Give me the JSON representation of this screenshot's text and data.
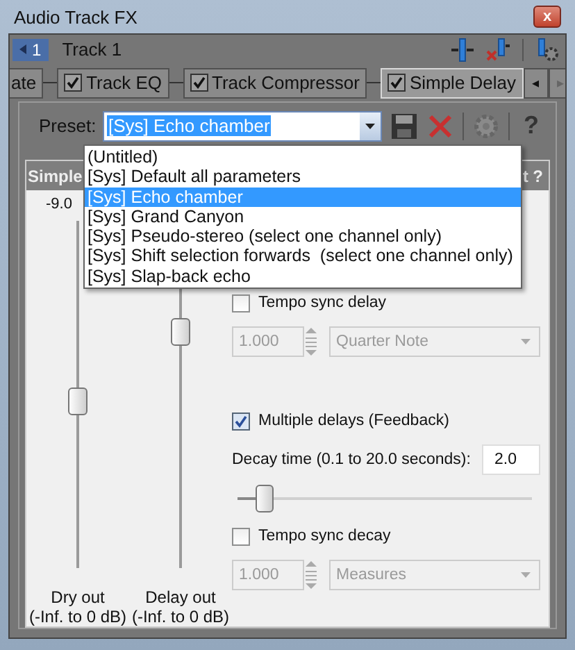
{
  "window": {
    "title": "Audio Track FX",
    "close": "x"
  },
  "track": {
    "number": "1",
    "name": "Track 1"
  },
  "chain": {
    "cut_plugin": "ate",
    "plugins": [
      {
        "label": "Track EQ",
        "checked": true,
        "selected": false
      },
      {
        "label": "Track Compressor",
        "checked": true,
        "selected": false
      },
      {
        "label": "Simple Delay",
        "checked": true,
        "selected": true
      }
    ],
    "scroll_left": "◂",
    "scroll_right": "▸"
  },
  "preset": {
    "label": "Preset:",
    "value": "[Sys] Echo chamber",
    "help": "?",
    "options": [
      {
        "label": "(Untitled)",
        "selected": false
      },
      {
        "label": "[Sys] Default all parameters",
        "selected": false
      },
      {
        "label": "[Sys] Echo chamber",
        "selected": true
      },
      {
        "label": "[Sys] Grand Canyon",
        "selected": false
      },
      {
        "label": "[Sys] Pseudo-stereo (select one channel only)",
        "selected": false
      },
      {
        "label": "[Sys] Shift selection forwards  (select one channel only)",
        "selected": false
      },
      {
        "label": "[Sys] Slap-back echo",
        "selected": false
      }
    ]
  },
  "panel": {
    "title": "Simple",
    "title_end": "t ?"
  },
  "sliders": [
    {
      "reading": "-9.0",
      "label": "Dry out",
      "range": "(-Inf. to 0 dB)",
      "level": 0.48
    },
    {
      "label": "Delay out",
      "range": "(-Inf. to 0 dB)",
      "level": 0.68
    }
  ],
  "control_groups": [
    [
      {
        "kind": "checkbox",
        "label": "Tempo sync delay",
        "checked": false
      },
      {
        "kind": "spin_combo",
        "value": "1.000",
        "unit": "Quarter Note",
        "disabled": true
      }
    ],
    [
      {
        "kind": "checkbox",
        "label": "Multiple delays (Feedback)",
        "checked": true
      },
      {
        "kind": "field",
        "label": "Decay time (0.1 to 20.0 seconds):",
        "value": "2.0"
      },
      {
        "kind": "slider",
        "level": 0.09
      },
      {
        "kind": "checkbox",
        "label": "Tempo sync decay",
        "checked": false
      },
      {
        "kind": "spin_combo",
        "value": "1.000",
        "unit": "Measures",
        "disabled": true
      }
    ]
  ]
}
